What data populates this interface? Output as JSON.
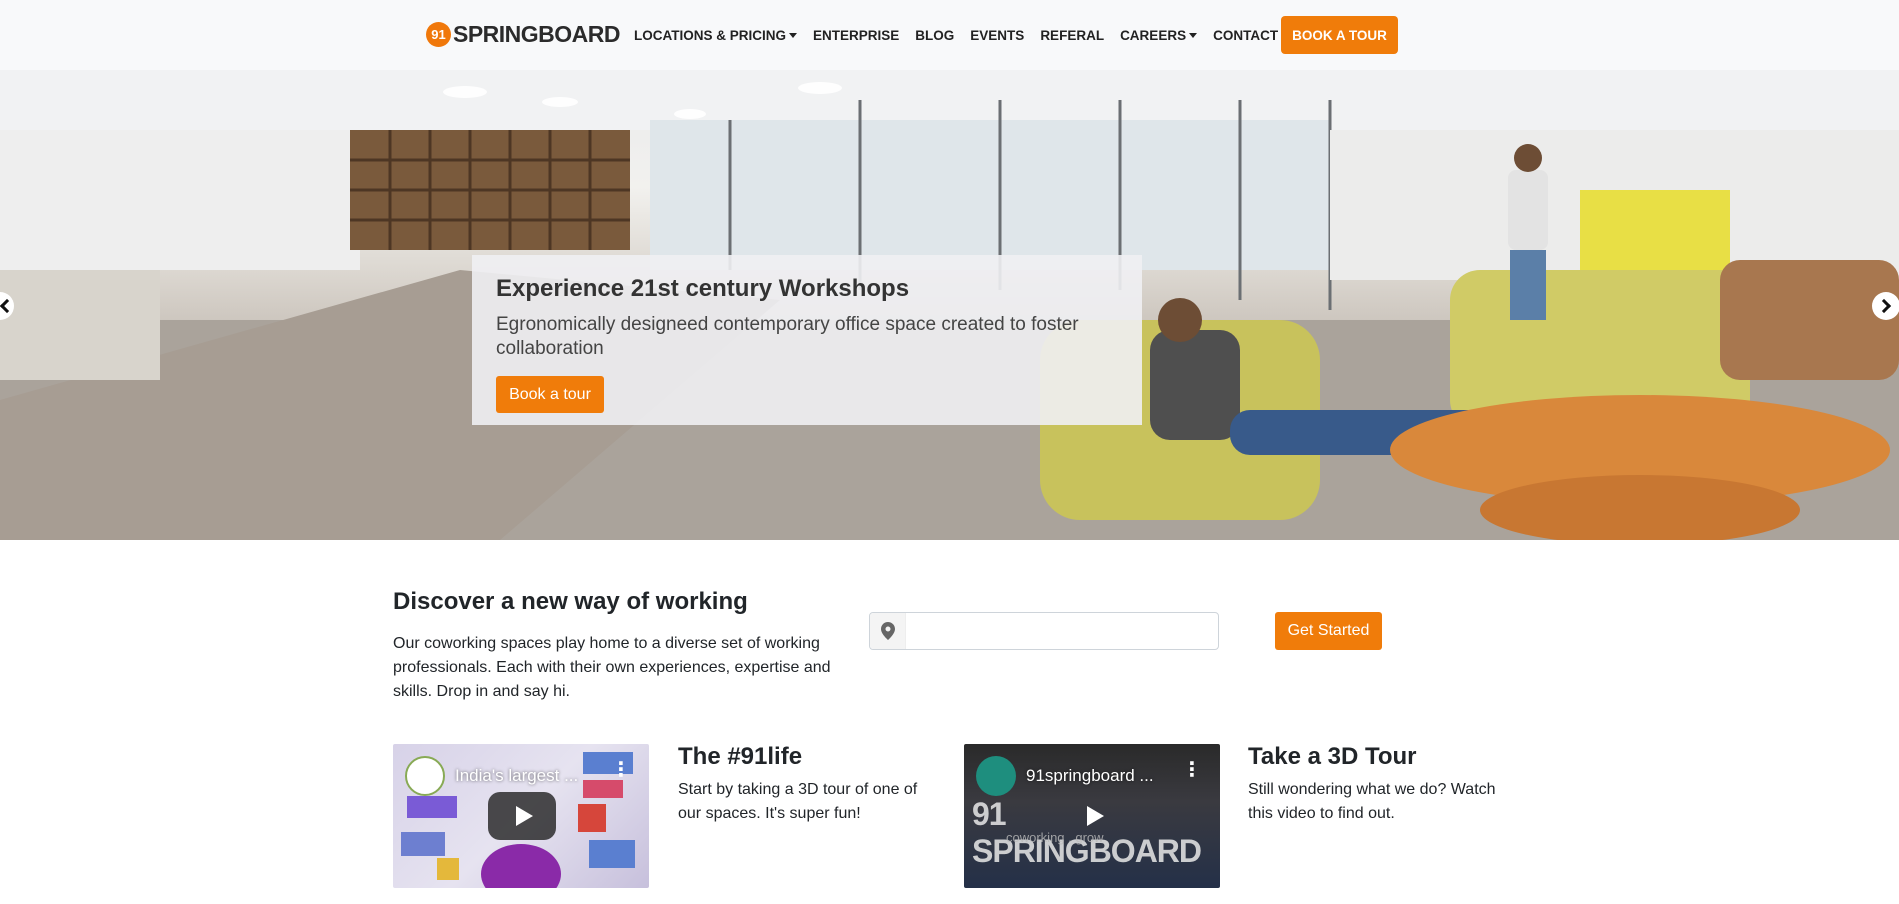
{
  "brand": {
    "badge": "91",
    "name": "SPRINGBOARD"
  },
  "nav": {
    "items": [
      {
        "label": "LOCATIONS & PRICING",
        "dropdown": true
      },
      {
        "label": "ENTERPRISE",
        "dropdown": false
      },
      {
        "label": "BLOG",
        "dropdown": false
      },
      {
        "label": "EVENTS",
        "dropdown": false
      },
      {
        "label": "REFERAL",
        "dropdown": false
      },
      {
        "label": "CAREERS",
        "dropdown": true
      },
      {
        "label": "CONTACT",
        "dropdown": true
      }
    ],
    "cta": "BOOK A TOUR"
  },
  "hero": {
    "title": "Experience 21st century Workshops",
    "subtitle": "Egronomically designeed contemporary office space created to foster collaboration",
    "button": "Book a tour"
  },
  "discover": {
    "title": "Discover a new way of working",
    "text": "Our coworking spaces play home to a diverse set of working professionals. Each with their own experiences, expertise and skills. Drop in and say hi.",
    "input_value": "",
    "button": "Get Started"
  },
  "videos": [
    {
      "title": "India's largest ...",
      "heading": "The #91life",
      "text": "Start by taking a 3D tour of one of our spaces. It's super fun!"
    },
    {
      "title": "91springboard ...",
      "heading": "Take a 3D Tour",
      "text": "Still wondering what we do? Watch this video to find out.",
      "overlay_brand": "91 SPRINGBOARD",
      "overlay_sub": "coworking . grow"
    }
  ],
  "colors": {
    "accent": "#f07c0a",
    "navbar_bg": "#f8f9fa"
  },
  "icons": {
    "location": "map-marker-icon",
    "prev": "chevron-left-icon",
    "next": "chevron-right-icon",
    "play": "play-icon"
  }
}
